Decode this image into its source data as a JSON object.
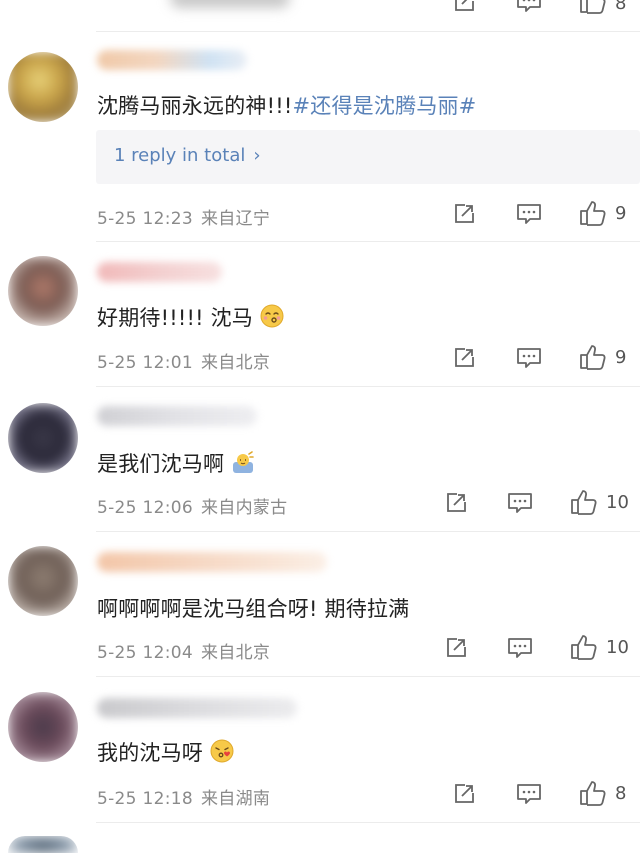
{
  "colors": {
    "link": "#5a82b8",
    "meta": "#8a8a8a",
    "icon": "#666666",
    "reply_bg": "#f5f5f7"
  },
  "comments": [
    {
      "text_plain": "沈腾马丽永远的神!!!",
      "hashtag": "#还得是沈腾马丽#",
      "reply_link": "1 reply in total",
      "date": "5-25 12:23",
      "location": "来自辽宁",
      "likes": "9"
    },
    {
      "text_plain": "好期待!!!!! 沈马",
      "emoji": "kissing-face-emoji",
      "date": "5-25 12:01",
      "location": "来自北京",
      "likes": "9"
    },
    {
      "text_plain": "是我们沈马啊",
      "emoji": "waving-person-emoji",
      "date": "5-25 12:06",
      "location": "来自内蒙古",
      "likes": "10"
    },
    {
      "text_plain": "啊啊啊啊是沈马组合呀! 期待拉满",
      "date": "5-25 12:04",
      "location": "来自北京",
      "likes": "10"
    },
    {
      "text_plain": "我的沈马呀",
      "emoji": "kiss-heart-face-emoji",
      "date": "5-25 12:18",
      "location": "来自湖南",
      "likes": "8"
    }
  ],
  "top_partial": {
    "likes": "8"
  }
}
